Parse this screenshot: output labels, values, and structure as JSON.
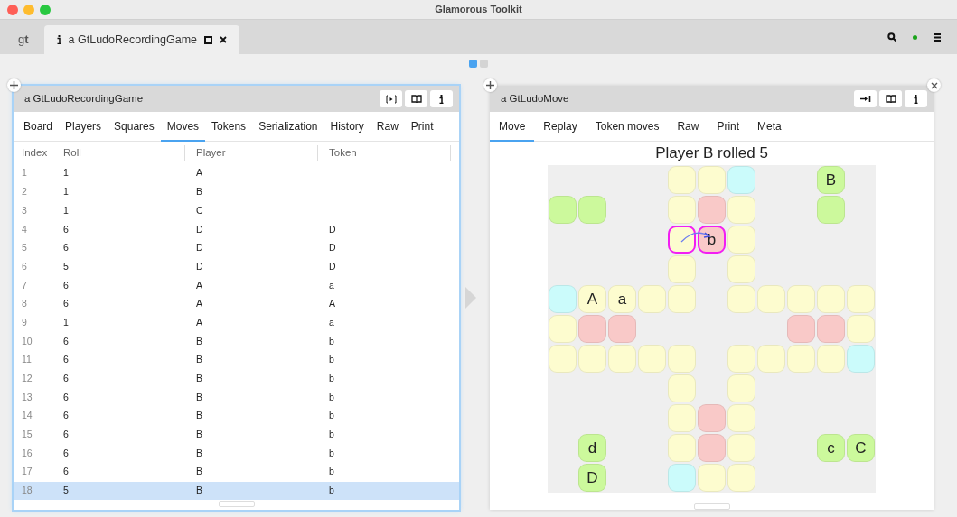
{
  "window": {
    "title": "Glamorous Toolkit"
  },
  "app_tabs": [
    {
      "kind": "logo",
      "label": "g**t**",
      "selected": false
    },
    {
      "kind": "inspector",
      "label": "a GtLudoRecordingGame",
      "selected": true
    }
  ],
  "pager": [
    {
      "selected": true
    },
    {
      "selected": false
    }
  ],
  "left_pane": {
    "title": "a GtLudoRecordingGame",
    "tabs": [
      {
        "label": "Board",
        "selected": false
      },
      {
        "label": "Players",
        "selected": false
      },
      {
        "label": "Squares",
        "selected": false
      },
      {
        "label": "Moves",
        "selected": true
      },
      {
        "label": "Tokens",
        "selected": false
      },
      {
        "label": "Serialization",
        "selected": false
      },
      {
        "label": "History",
        "selected": false
      },
      {
        "label": "Raw",
        "selected": false
      },
      {
        "label": "Print",
        "selected": false
      }
    ],
    "table": {
      "columns": [
        "Index",
        "Roll",
        "Player",
        "Token"
      ],
      "rows": [
        {
          "cells": [
            "1",
            "1",
            "A",
            ""
          ],
          "selected": false
        },
        {
          "cells": [
            "2",
            "1",
            "B",
            ""
          ],
          "selected": false
        },
        {
          "cells": [
            "3",
            "1",
            "C",
            ""
          ],
          "selected": false
        },
        {
          "cells": [
            "4",
            "6",
            "D",
            "D"
          ],
          "selected": false
        },
        {
          "cells": [
            "5",
            "6",
            "D",
            "D"
          ],
          "selected": false
        },
        {
          "cells": [
            "6",
            "5",
            "D",
            "D"
          ],
          "selected": false
        },
        {
          "cells": [
            "7",
            "6",
            "A",
            "a"
          ],
          "selected": false
        },
        {
          "cells": [
            "8",
            "6",
            "A",
            "A"
          ],
          "selected": false
        },
        {
          "cells": [
            "9",
            "1",
            "A",
            "a"
          ],
          "selected": false
        },
        {
          "cells": [
            "10",
            "6",
            "B",
            "b"
          ],
          "selected": false
        },
        {
          "cells": [
            "11",
            "6",
            "B",
            "b"
          ],
          "selected": false
        },
        {
          "cells": [
            "12",
            "6",
            "B",
            "b"
          ],
          "selected": false
        },
        {
          "cells": [
            "13",
            "6",
            "B",
            "b"
          ],
          "selected": false
        },
        {
          "cells": [
            "14",
            "6",
            "B",
            "b"
          ],
          "selected": false
        },
        {
          "cells": [
            "15",
            "6",
            "B",
            "b"
          ],
          "selected": false
        },
        {
          "cells": [
            "16",
            "6",
            "B",
            "b"
          ],
          "selected": false
        },
        {
          "cells": [
            "17",
            "6",
            "B",
            "b"
          ],
          "selected": false
        },
        {
          "cells": [
            "18",
            "5",
            "B",
            "b"
          ],
          "selected": true
        }
      ]
    }
  },
  "right_pane": {
    "title": "a GtLudoMove",
    "tabs": [
      {
        "label": "Move",
        "selected": true
      },
      {
        "label": "Replay",
        "selected": false
      },
      {
        "label": "Token moves",
        "selected": false
      },
      {
        "label": "Raw",
        "selected": false
      },
      {
        "label": "Print",
        "selected": false
      },
      {
        "label": "Meta",
        "selected": false
      }
    ],
    "heading": "Player B rolled 5",
    "board": {
      "rows": [
        [
          null,
          null,
          null,
          null,
          {
            "color": "#fdfccf"
          },
          {
            "color": "#fdfccf"
          },
          {
            "color": "#cbfbfb"
          },
          null,
          null,
          {
            "color": "#ccf99c",
            "label": "B"
          },
          null
        ],
        [
          {
            "color": "#ccf99c"
          },
          {
            "color": "#ccf99c"
          },
          null,
          null,
          {
            "color": "#fdfccf"
          },
          {
            "color": "#f9c9c8"
          },
          {
            "color": "#fdfccf"
          },
          null,
          null,
          {
            "color": "#ccf99c"
          },
          null
        ],
        [
          null,
          null,
          null,
          null,
          {
            "color": "#fdfccf",
            "highlighted": true
          },
          {
            "color": "#f9c9c8",
            "label": "b",
            "highlighted": true
          },
          {
            "color": "#fdfccf"
          },
          null,
          null,
          null,
          null
        ],
        [
          null,
          null,
          null,
          null,
          {
            "color": "#fdfccf"
          },
          null,
          {
            "color": "#fdfccf"
          },
          null,
          null,
          null,
          null
        ],
        [
          {
            "color": "#cbfbfb"
          },
          {
            "color": "#fdfccf",
            "label": "A"
          },
          {
            "color": "#fdfccf",
            "label": "a"
          },
          {
            "color": "#fdfccf"
          },
          {
            "color": "#fdfccf"
          },
          null,
          {
            "color": "#fdfccf"
          },
          {
            "color": "#fdfccf"
          },
          {
            "color": "#fdfccf"
          },
          {
            "color": "#fdfccf"
          },
          {
            "color": "#fdfccf"
          }
        ],
        [
          {
            "color": "#fdfccf"
          },
          {
            "color": "#f9c9c8"
          },
          {
            "color": "#f9c9c8"
          },
          null,
          null,
          null,
          null,
          null,
          {
            "color": "#f9c9c8"
          },
          {
            "color": "#f9c9c8"
          },
          {
            "color": "#fdfccf"
          }
        ],
        [
          {
            "color": "#fdfccf"
          },
          {
            "color": "#fdfccf"
          },
          {
            "color": "#fdfccf"
          },
          {
            "color": "#fdfccf"
          },
          {
            "color": "#fdfccf"
          },
          null,
          {
            "color": "#fdfccf"
          },
          {
            "color": "#fdfccf"
          },
          {
            "color": "#fdfccf"
          },
          {
            "color": "#fdfccf"
          },
          {
            "color": "#cbfbfb"
          }
        ],
        [
          null,
          null,
          null,
          null,
          {
            "color": "#fdfccf"
          },
          null,
          {
            "color": "#fdfccf"
          },
          null,
          null,
          null,
          null
        ],
        [
          null,
          null,
          null,
          null,
          {
            "color": "#fdfccf"
          },
          {
            "color": "#f9c9c8"
          },
          {
            "color": "#fdfccf"
          },
          null,
          null,
          null,
          null
        ],
        [
          null,
          {
            "color": "#ccf99c",
            "label": "d"
          },
          null,
          null,
          {
            "color": "#fdfccf"
          },
          {
            "color": "#f9c9c8"
          },
          {
            "color": "#fdfccf"
          },
          null,
          null,
          {
            "color": "#ccf99c",
            "label": "c"
          },
          {
            "color": "#ccf99c",
            "label": "C"
          }
        ],
        [
          null,
          {
            "color": "#ccf99c",
            "label": "D"
          },
          null,
          null,
          {
            "color": "#cbfbfb"
          },
          {
            "color": "#fdfccf"
          },
          {
            "color": "#fdfccf"
          },
          null,
          null,
          null,
          null
        ]
      ]
    }
  }
}
